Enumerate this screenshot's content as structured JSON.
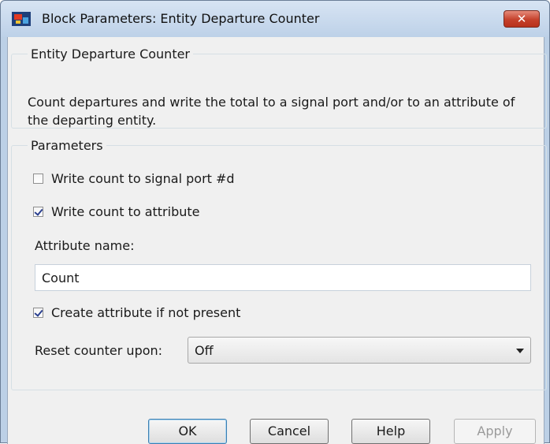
{
  "window": {
    "title": "Block Parameters: Entity Departure Counter",
    "close_label": "✕"
  },
  "description": {
    "group_title": "Entity Departure Counter",
    "text": "Count departures and write the total to a signal port and/or to an attribute of the departing entity."
  },
  "parameters": {
    "group_title": "Parameters",
    "write_signal_port": {
      "label": "Write count to signal port #d",
      "checked": false
    },
    "write_attribute": {
      "label": "Write count to attribute",
      "checked": true
    },
    "attribute_name_label": "Attribute name:",
    "attribute_name_value": "Count",
    "create_attribute": {
      "label": "Create attribute if not present",
      "checked": true
    },
    "reset_label": "Reset counter upon:",
    "reset_value": "Off"
  },
  "buttons": {
    "ok": "OK",
    "cancel": "Cancel",
    "help": "Help",
    "apply": "Apply"
  }
}
